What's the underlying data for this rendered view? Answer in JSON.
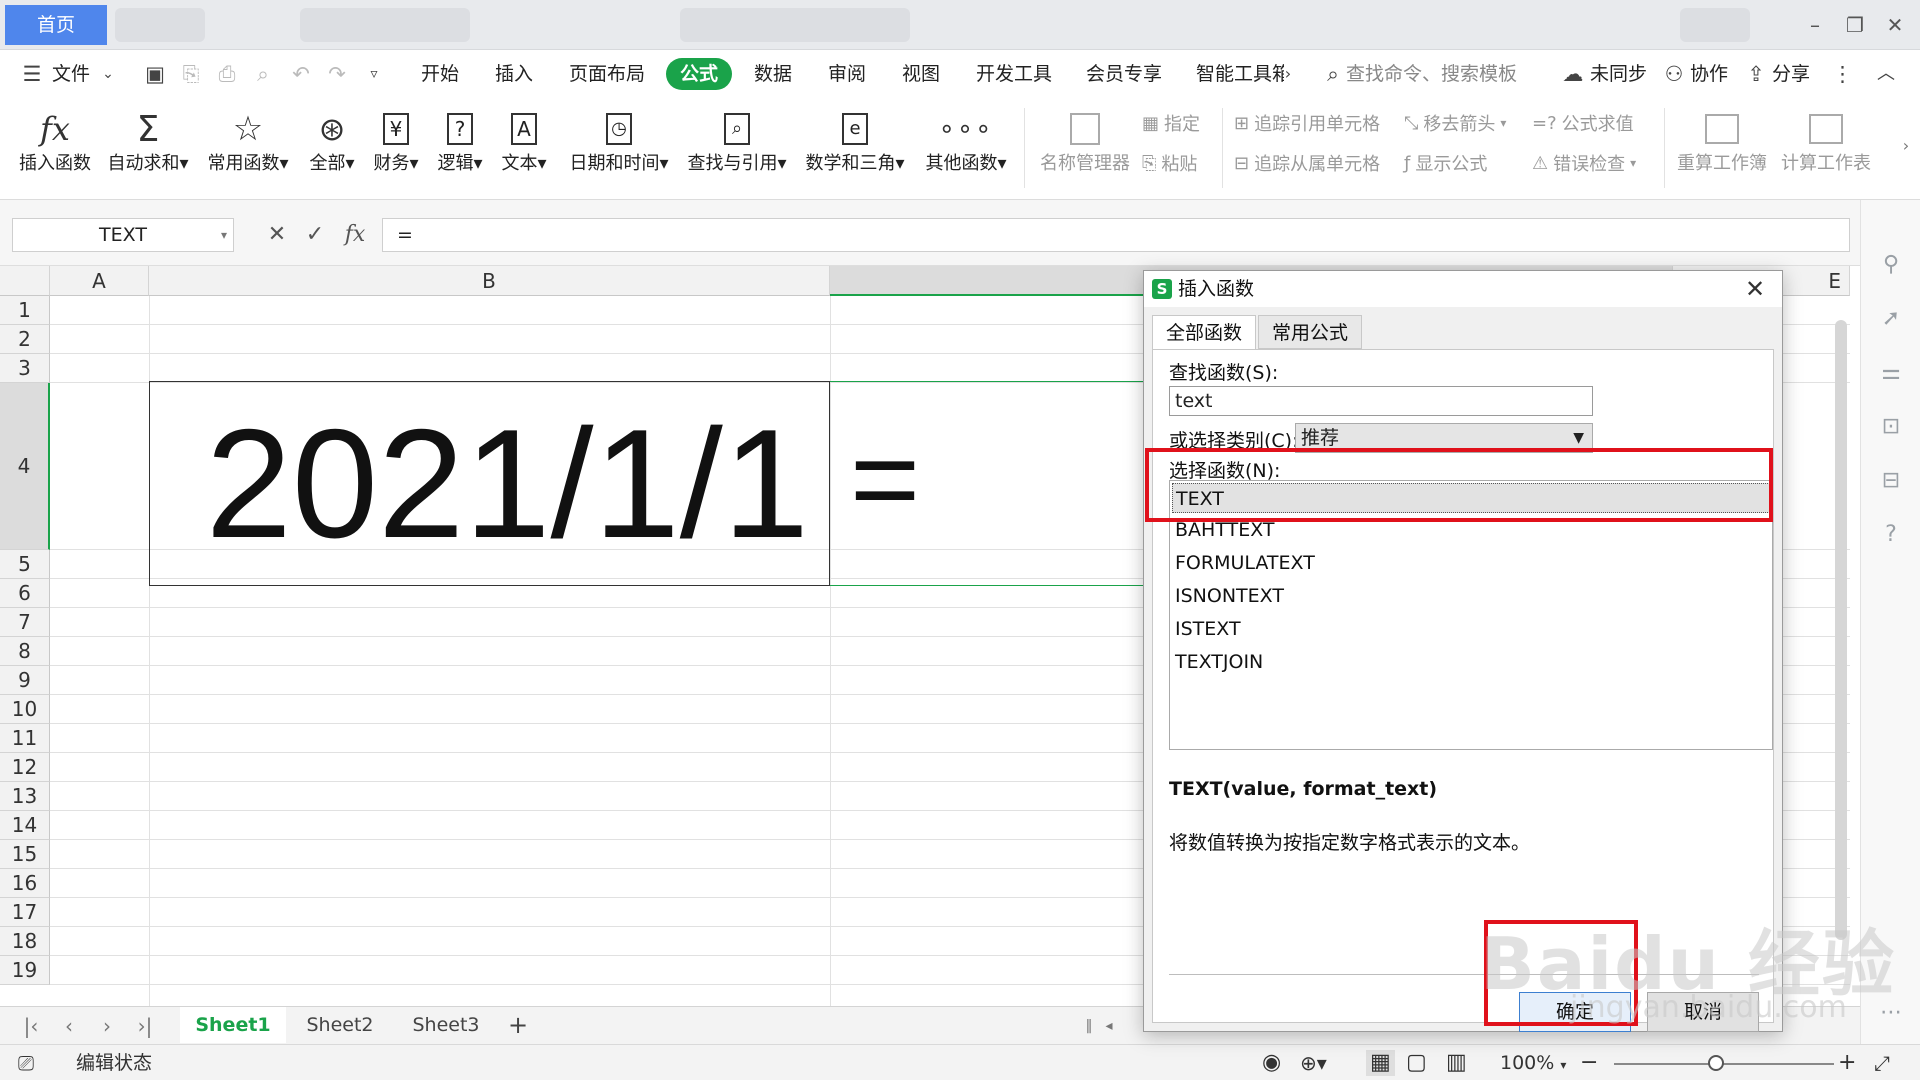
{
  "titlebar": {
    "home_tab": "首页"
  },
  "menu": {
    "file": "文件",
    "items": [
      "开始",
      "插入",
      "页面布局",
      "公式",
      "数据",
      "审阅",
      "视图",
      "开发工具",
      "会员专享",
      "智能工具箱"
    ],
    "active": "公式",
    "search_placeholder": "查找命令、搜索模板",
    "sync": "未同步",
    "collab": "协作",
    "share": "分享"
  },
  "ribbon": {
    "buttons": [
      {
        "label": "插入函数",
        "icon": "fx-icon"
      },
      {
        "label": "自动求和",
        "icon": "sigma-icon"
      },
      {
        "label": "常用函数",
        "icon": "star-icon"
      },
      {
        "label": "全部",
        "icon": "asterisk-icon"
      },
      {
        "label": "财务",
        "icon": "yen-icon"
      },
      {
        "label": "逻辑",
        "icon": "question-icon"
      },
      {
        "label": "文本",
        "icon": "text-a-icon"
      },
      {
        "label": "日期和时间",
        "icon": "clock-icon"
      },
      {
        "label": "查找与引用",
        "icon": "lookup-icon"
      },
      {
        "label": "数学和三角",
        "icon": "theta-icon"
      },
      {
        "label": "其他函数",
        "icon": "more-dots-icon"
      }
    ],
    "name_manager": "名称管理器",
    "specify": "指定",
    "paste": "粘贴",
    "trace_precedents": "追踪引用单元格",
    "trace_dependents": "追踪从属单元格",
    "remove_arrows": "移去箭头",
    "show_formulas": "显示公式",
    "evaluate": "公式求值",
    "error_check": "错误检查",
    "recalc_book": "重算工作簿",
    "calc_sheet": "计算工作表"
  },
  "formula_bar": {
    "name_box": "TEXT",
    "content": "="
  },
  "grid": {
    "columns": [
      "A",
      "B",
      "E"
    ],
    "rows": [
      "1",
      "2",
      "3",
      "4",
      "5",
      "6",
      "7",
      "8",
      "9",
      "10",
      "11",
      "12",
      "13",
      "14",
      "15",
      "16",
      "17",
      "18",
      "19"
    ],
    "b4": "2021/1/1",
    "c4": "="
  },
  "sheets": {
    "tabs": [
      "Sheet1",
      "Sheet2",
      "Sheet3"
    ],
    "active": "Sheet1",
    "add": "+"
  },
  "status": {
    "mode": "编辑状态",
    "zoom": "100%"
  },
  "dialog": {
    "title": "插入函数",
    "tabs": [
      "全部函数",
      "常用公式"
    ],
    "search_label": "查找函数(S):",
    "search_value": "text",
    "category_label": "或选择类别(C):",
    "category_value": "推荐",
    "list_label": "选择函数(N):",
    "functions": [
      "TEXT",
      "BAHTTEXT",
      "FORMULATEXT",
      "ISNONTEXT",
      "ISTEXT",
      "TEXTJOIN"
    ],
    "selected": "TEXT",
    "signature": "TEXT(value, format_text)",
    "description": "将数值转换为按指定数字格式表示的文本。",
    "ok": "确定",
    "cancel": "取消"
  },
  "watermark": {
    "brand": "Baidu 经验",
    "url": "jingyan.baidu.com"
  },
  "colors": {
    "accent_green": "#1aa34a",
    "home_tab_blue": "#4f86ec",
    "annotation_red": "#e0111b"
  }
}
